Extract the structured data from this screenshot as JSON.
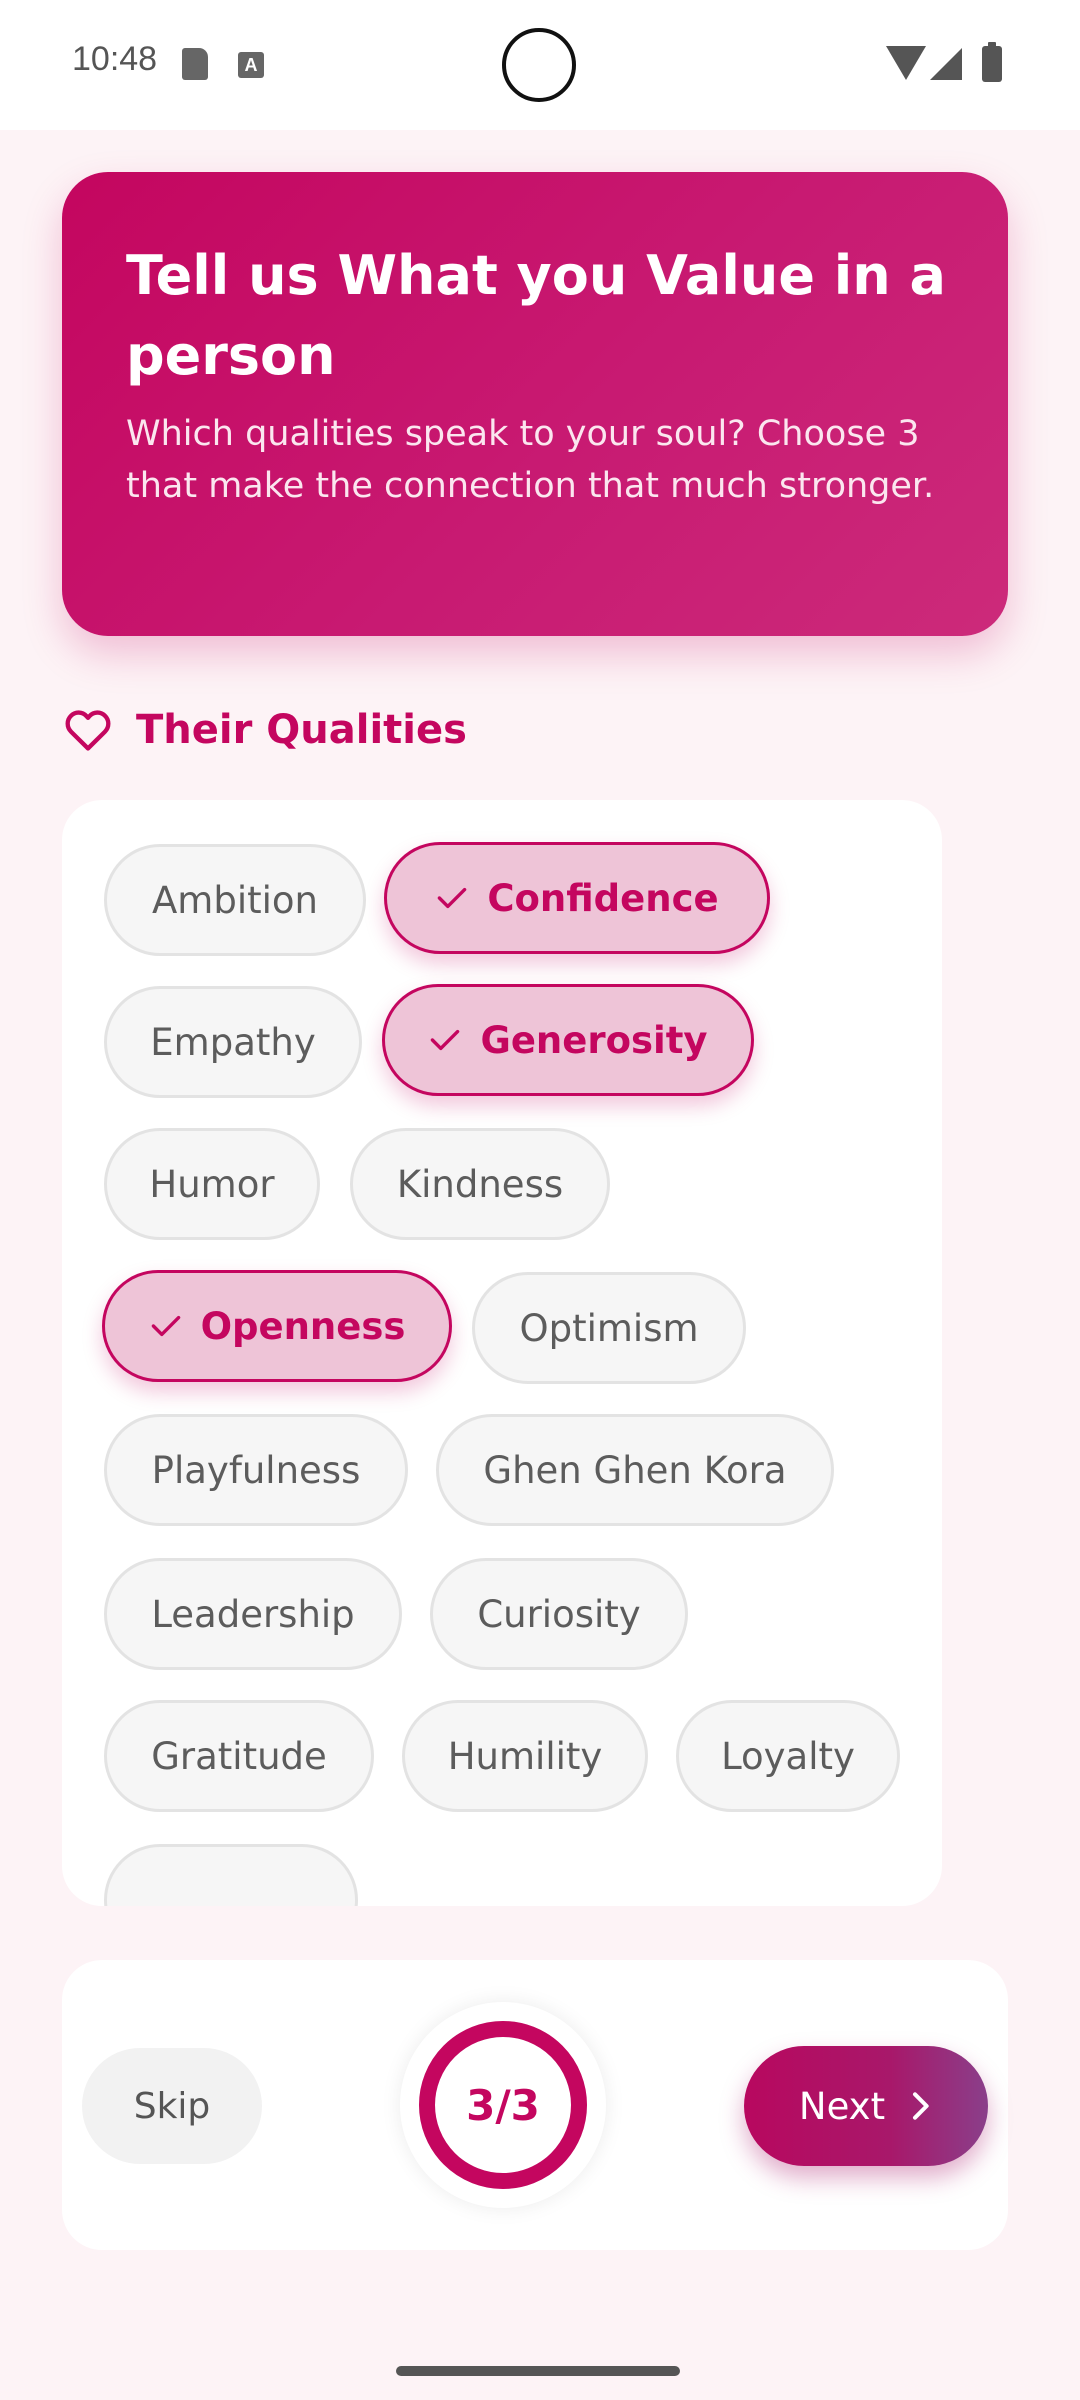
{
  "status_bar": {
    "time": "10:48",
    "icons": [
      "sd-card-icon",
      "a-notification-icon",
      "wifi-icon",
      "signal-icon",
      "battery-icon"
    ]
  },
  "hero": {
    "title": "Tell us What you Value in a person",
    "subtitle": "Which qualities speak to your soul? Choose 3 that make the connection that much stronger."
  },
  "section": {
    "title": "Their Qualities",
    "icon": "heart-icon"
  },
  "qualities": [
    {
      "label": "Ambition",
      "selected": false
    },
    {
      "label": "Confidence",
      "selected": true
    },
    {
      "label": "Empathy",
      "selected": false
    },
    {
      "label": "Generosity",
      "selected": true
    },
    {
      "label": "Humor",
      "selected": false
    },
    {
      "label": "Kindness",
      "selected": false
    },
    {
      "label": "Openness",
      "selected": true
    },
    {
      "label": "Optimism",
      "selected": false
    },
    {
      "label": "Playfulness",
      "selected": false
    },
    {
      "label": "Ghen Ghen Kora",
      "selected": false
    },
    {
      "label": "Leadership",
      "selected": false
    },
    {
      "label": "Curiosity",
      "selected": false
    },
    {
      "label": "Gratitude",
      "selected": false
    },
    {
      "label": "Humility",
      "selected": false
    },
    {
      "label": "Loyalty",
      "selected": false
    }
  ],
  "footer": {
    "skip_label": "Skip",
    "progress_text": "3/3",
    "progress_fraction": 1.0,
    "next_label": "Next"
  },
  "colors": {
    "accent": "#c4065f",
    "chip_selected_bg": "#eec4d7",
    "chip_bg": "#f6f6f6",
    "background": "#fdf3f6"
  }
}
